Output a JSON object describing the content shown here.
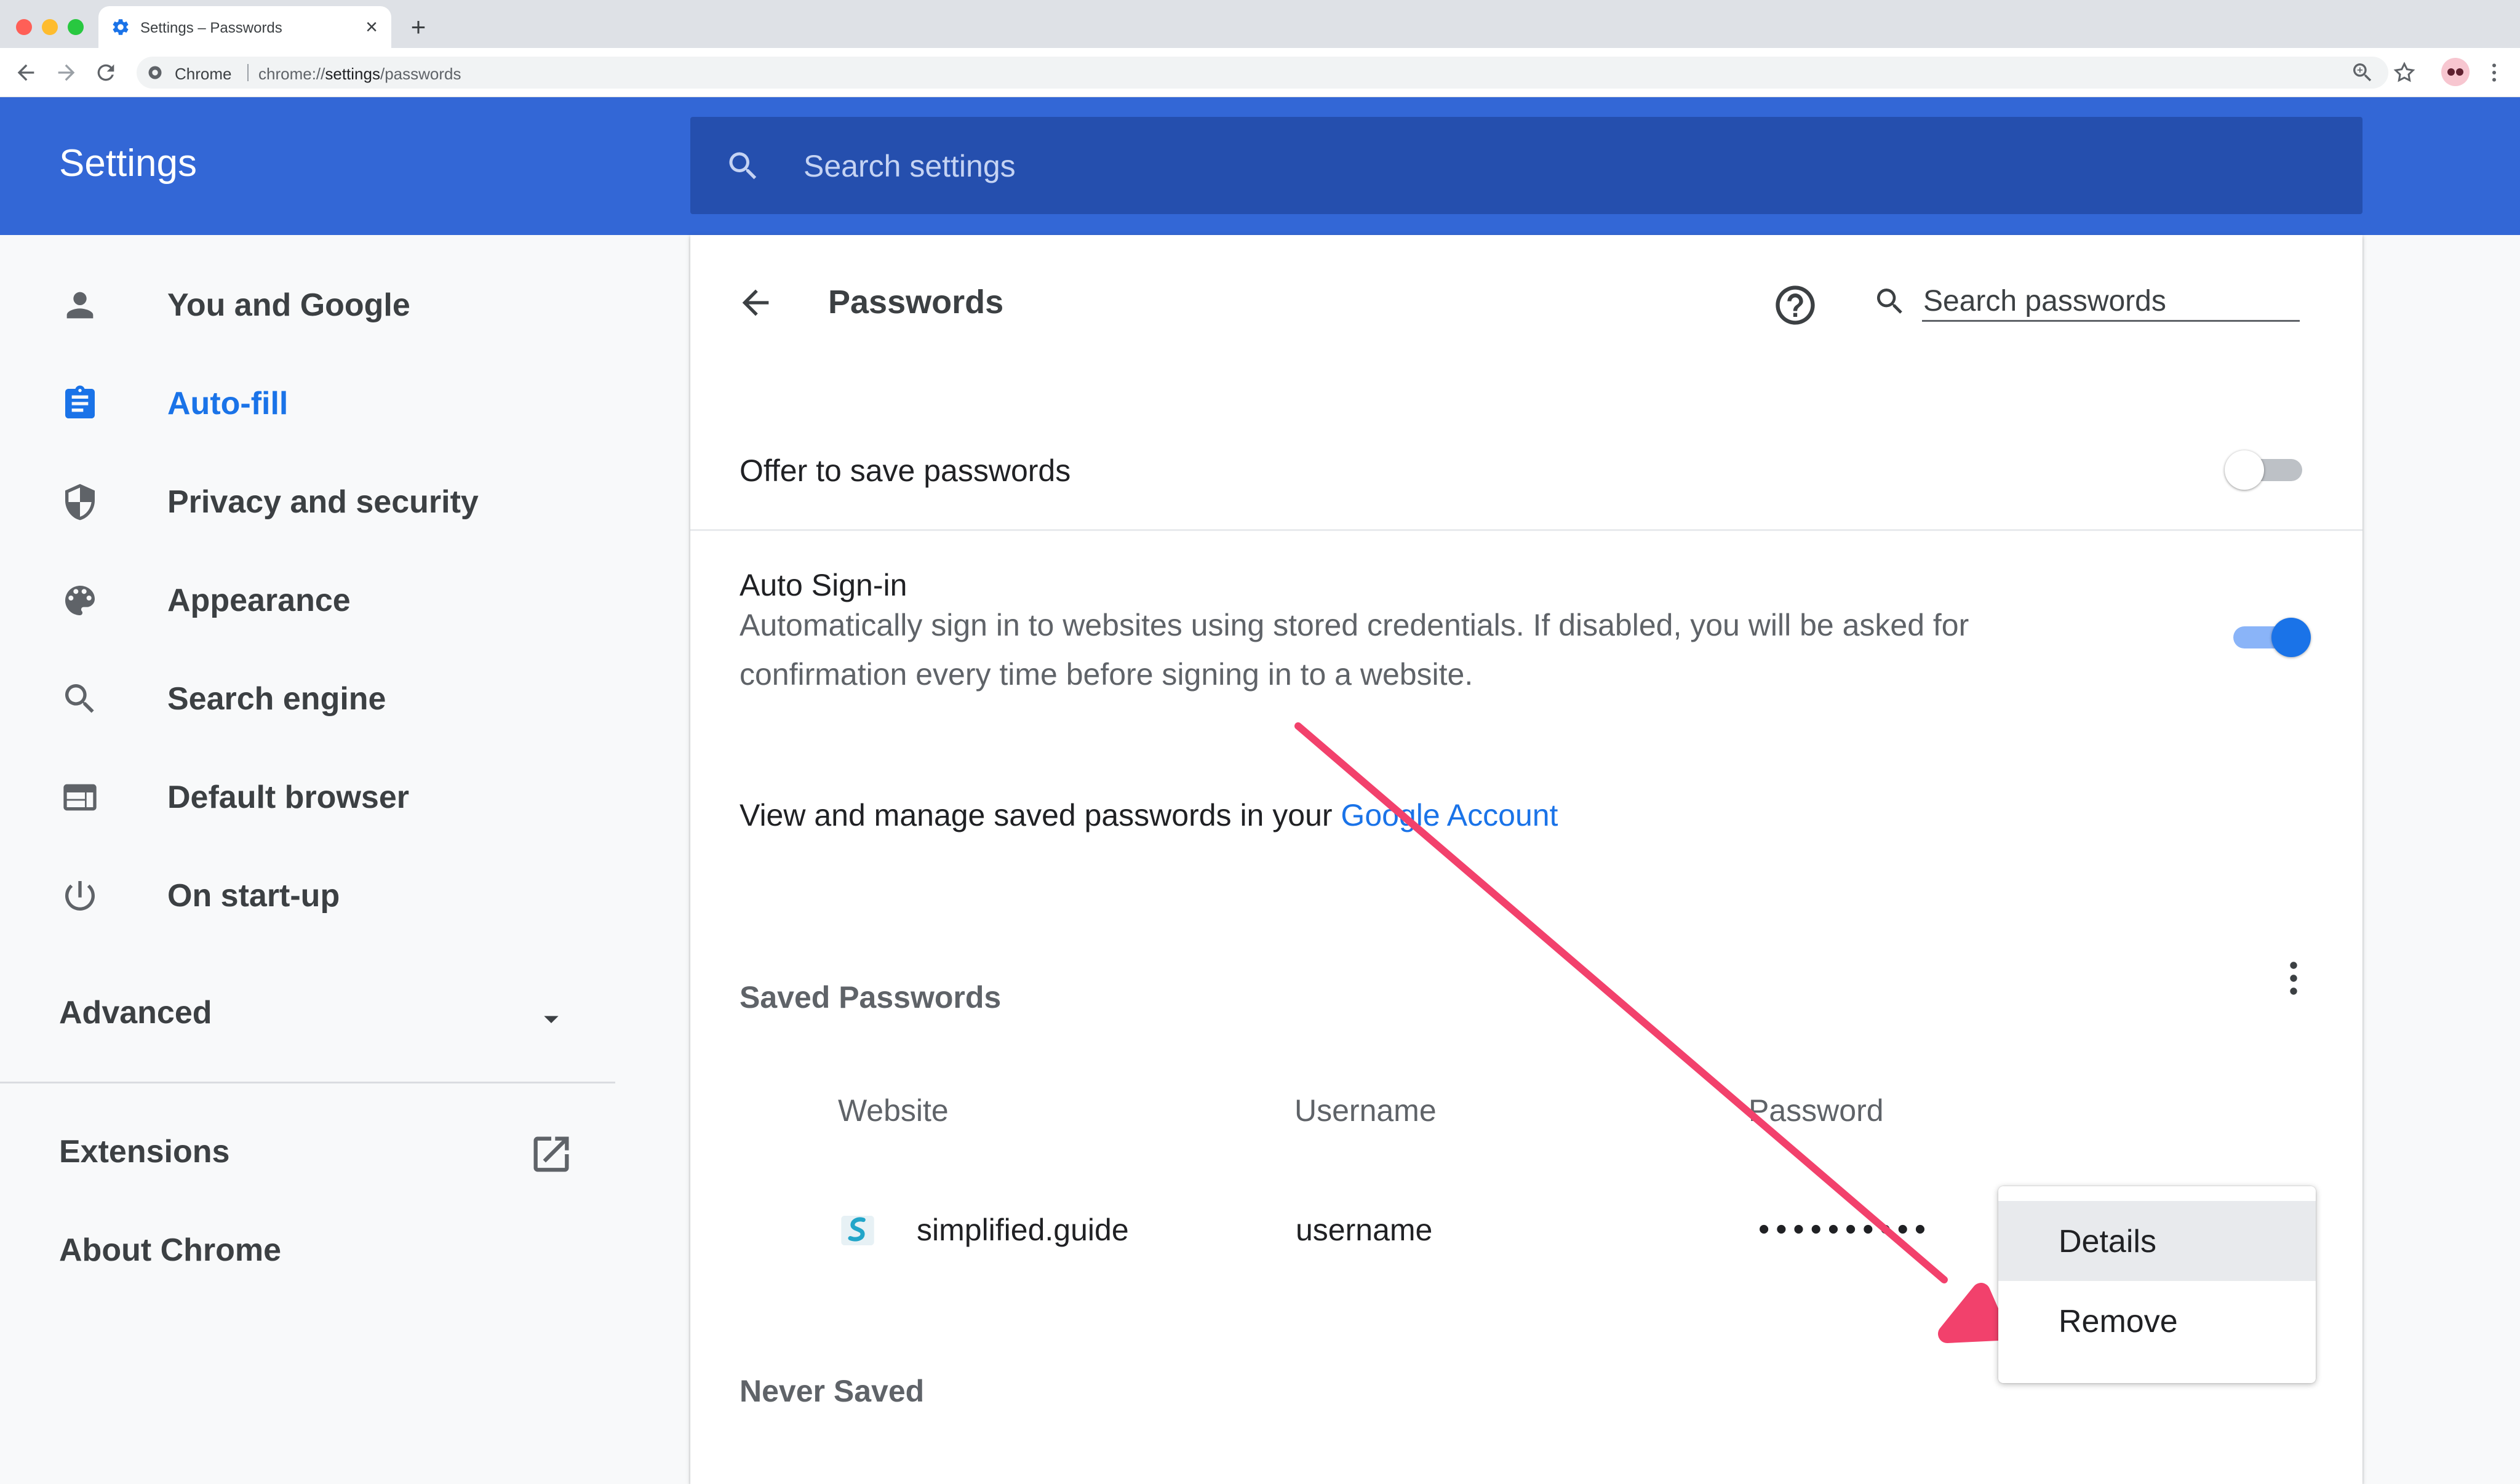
{
  "browser": {
    "tab_title": "Settings – Passwords",
    "omnibox_chip": "Chrome",
    "url_prefix": "chrome://",
    "url_bold": "settings",
    "url_suffix": "/passwords"
  },
  "header": {
    "title": "Settings",
    "search_placeholder": "Search settings"
  },
  "sidebar": {
    "items": [
      {
        "label": "You and Google",
        "icon": "person-icon"
      },
      {
        "label": "Auto-fill",
        "icon": "clipboard-icon",
        "active": true
      },
      {
        "label": "Privacy and security",
        "icon": "shield-icon"
      },
      {
        "label": "Appearance",
        "icon": "palette-icon"
      },
      {
        "label": "Search engine",
        "icon": "search-icon"
      },
      {
        "label": "Default browser",
        "icon": "browser-window-icon"
      },
      {
        "label": "On start-up",
        "icon": "power-icon"
      }
    ],
    "advanced_label": "Advanced",
    "extensions_label": "Extensions",
    "about_label": "About Chrome"
  },
  "passwords_page": {
    "title": "Passwords",
    "search_placeholder": "Search passwords",
    "offer_to_save_label": "Offer to save passwords",
    "offer_to_save_enabled": false,
    "auto_signin_title": "Auto Sign-in",
    "auto_signin_desc": "Automatically sign in to websites using stored credentials. If disabled, you will be asked for confirmation every time before signing in to a website.",
    "auto_signin_enabled": true,
    "manage_text": "View and manage saved passwords in your ",
    "manage_link": "Google Account",
    "saved_heading": "Saved Passwords",
    "columns": [
      "Website",
      "Username",
      "Password"
    ],
    "entries": [
      {
        "website": "simplified.guide",
        "username": "username",
        "password": "••••••••••"
      }
    ],
    "never_saved_heading": "Never Saved"
  },
  "menu": {
    "items": [
      "Details",
      "Remove"
    ]
  },
  "colors": {
    "header_blue": "#3367d6",
    "search_bar": "#254fae",
    "accent": "#1a73e8",
    "annotation_arrow": "#f2416c"
  }
}
